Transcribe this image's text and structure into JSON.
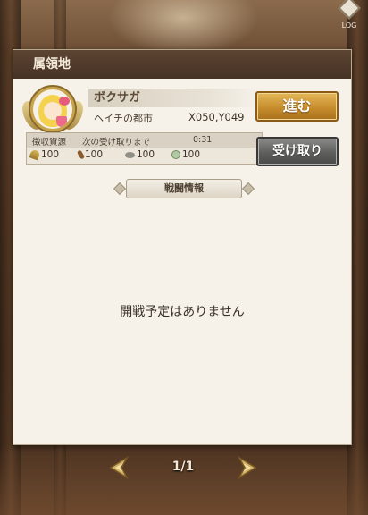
{
  "log_button": {
    "label": "LOG",
    "icon": "scroll-book-icon"
  },
  "panel": {
    "title": "属領地",
    "territory": {
      "emblem_icon": "character-portrait-emblem",
      "name": "ボクサガ",
      "city": "ヘイチの都市",
      "coords": "X050,Y049",
      "go_label": "進む",
      "go_color": "#c78d2c"
    },
    "resources": {
      "label": "徴収資源",
      "next_label": "次の受け取りまで",
      "timer": "0:31",
      "items": [
        {
          "icon": "wheat-icon",
          "value": "100"
        },
        {
          "icon": "wood-icon",
          "value": "100"
        },
        {
          "icon": "stone-icon",
          "value": "100"
        },
        {
          "icon": "ore-icon",
          "value": "100"
        }
      ],
      "receive_label": "受け取り"
    },
    "battle": {
      "header": "戦闘情報",
      "empty_message": "開戦予定はありません"
    }
  },
  "pager": {
    "text": "1/1",
    "prev_icon": "arrow-left-icon",
    "next_icon": "arrow-right-icon"
  }
}
